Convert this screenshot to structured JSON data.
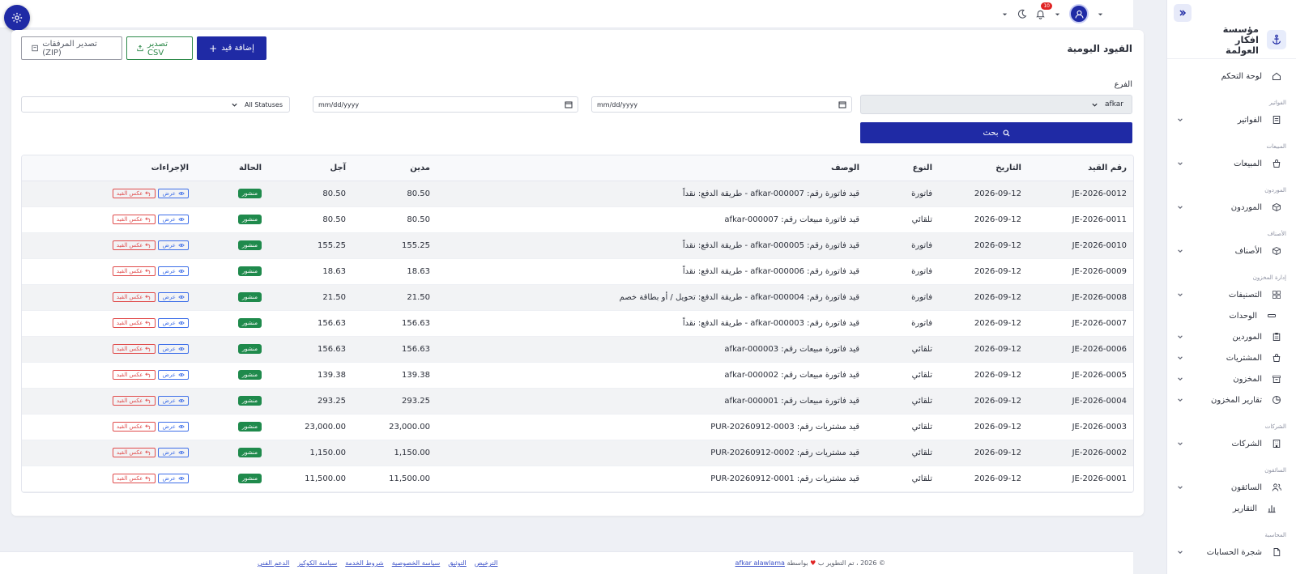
{
  "topbar": {
    "notification_count": "10"
  },
  "sidebar": {
    "brand_name": "مؤسسة افكار العولمة",
    "items": [
      {
        "type": "item",
        "label": "لوحة التحكم",
        "icon": "home-icon",
        "chevron": false
      },
      {
        "type": "section",
        "label": "الفواتير"
      },
      {
        "type": "item",
        "label": "الفواتير",
        "icon": "invoice-icon",
        "chevron": true
      },
      {
        "type": "section",
        "label": "المبيعات"
      },
      {
        "type": "item",
        "label": "المبيعات",
        "icon": "bag-icon",
        "chevron": true
      },
      {
        "type": "section",
        "label": "الموردون"
      },
      {
        "type": "item",
        "label": "الموردون",
        "icon": "box-icon",
        "chevron": true
      },
      {
        "type": "section",
        "label": "الأصناف"
      },
      {
        "type": "item",
        "label": "الأصناف",
        "icon": "box-icon",
        "chevron": true
      },
      {
        "type": "section",
        "label": "إدارة المخزون"
      },
      {
        "type": "item",
        "label": "التصنيفات",
        "icon": "grid-icon",
        "chevron": true
      },
      {
        "type": "sub",
        "label": "الوحدات",
        "icon": "unit-icon",
        "chevron": false
      },
      {
        "type": "item",
        "label": "الموردين",
        "icon": "clipboard-icon",
        "chevron": true
      },
      {
        "type": "item",
        "label": "المشتريات",
        "icon": "bag-icon",
        "chevron": true
      },
      {
        "type": "item",
        "label": "المخزون",
        "icon": "archive-icon",
        "chevron": true
      },
      {
        "type": "item",
        "label": "تقارير المخزون",
        "icon": "pie-icon",
        "chevron": true
      },
      {
        "type": "section",
        "label": "الشركات"
      },
      {
        "type": "item",
        "label": "الشركات",
        "icon": "building-icon",
        "chevron": true
      },
      {
        "type": "section",
        "label": "السائقون"
      },
      {
        "type": "item",
        "label": "السائقون",
        "icon": "users-icon",
        "chevron": true
      },
      {
        "type": "sub",
        "label": "التقارير",
        "icon": "bars-icon",
        "chevron": false
      },
      {
        "type": "section",
        "label": "المحاسبة"
      },
      {
        "type": "item",
        "label": "شجرة الحسابات",
        "icon": "doc-icon",
        "chevron": true
      }
    ]
  },
  "page": {
    "title": "القيود اليومية",
    "add_button": "إضافة قيد",
    "csv_button": "تصدير CSV",
    "zip_button": "تصدير المرفقات (ZIP)"
  },
  "filters": {
    "branch_label": "الفرع",
    "branch_value": "afkar",
    "date_from_placeholder": "mm/dd/yyyy",
    "date_to_placeholder": "mm/dd/yyyy",
    "status_value": "All Statuses",
    "search_button": "بحث"
  },
  "table": {
    "headers": [
      "رقم القيد",
      "التاريخ",
      "النوع",
      "الوصف",
      "مدين",
      "آجل",
      "الحالة",
      "الإجراءات"
    ],
    "view_label": "عرض",
    "reverse_label": "عكس القيد",
    "rows": [
      {
        "id": "JE-2026-0012",
        "date": "2026-09-12",
        "type": "فاتورة",
        "desc": "قيد فاتورة رقم: afkar-000007 - طريقة الدفع: نقداً",
        "debit": "80.50",
        "credit": "80.50",
        "status": "منشور"
      },
      {
        "id": "JE-2026-0011",
        "date": "2026-09-12",
        "type": "تلقائي",
        "desc": "قيد فاتورة مبيعات رقم: afkar-000007",
        "debit": "80.50",
        "credit": "80.50",
        "status": "منشور"
      },
      {
        "id": "JE-2026-0010",
        "date": "2026-09-12",
        "type": "فاتورة",
        "desc": "قيد فاتورة رقم: afkar-000005 - طريقة الدفع: نقداً",
        "debit": "155.25",
        "credit": "155.25",
        "status": "منشور"
      },
      {
        "id": "JE-2026-0009",
        "date": "2026-09-12",
        "type": "فاتورة",
        "desc": "قيد فاتورة رقم: afkar-000006 - طريقة الدفع: نقداً",
        "debit": "18.63",
        "credit": "18.63",
        "status": "منشور"
      },
      {
        "id": "JE-2026-0008",
        "date": "2026-09-12",
        "type": "فاتورة",
        "desc": "قيد فاتورة رقم: afkar-000004 - طريقة الدفع: تحويل / أو بطاقة خصم",
        "debit": "21.50",
        "credit": "21.50",
        "status": "منشور"
      },
      {
        "id": "JE-2026-0007",
        "date": "2026-09-12",
        "type": "فاتورة",
        "desc": "قيد فاتورة رقم: afkar-000003 - طريقة الدفع: نقداً",
        "debit": "156.63",
        "credit": "156.63",
        "status": "منشور"
      },
      {
        "id": "JE-2026-0006",
        "date": "2026-09-12",
        "type": "تلقائي",
        "desc": "قيد فاتورة مبيعات رقم: afkar-000003",
        "debit": "156.63",
        "credit": "156.63",
        "status": "منشور"
      },
      {
        "id": "JE-2026-0005",
        "date": "2026-09-12",
        "type": "تلقائي",
        "desc": "قيد فاتورة مبيعات رقم: afkar-000002",
        "debit": "139.38",
        "credit": "139.38",
        "status": "منشور"
      },
      {
        "id": "JE-2026-0004",
        "date": "2026-09-12",
        "type": "تلقائي",
        "desc": "قيد فاتورة مبيعات رقم: afkar-000001",
        "debit": "293.25",
        "credit": "293.25",
        "status": "منشور"
      },
      {
        "id": "JE-2026-0003",
        "date": "2026-09-12",
        "type": "تلقائي",
        "desc": "قيد مشتريات رقم: PUR-20260912-0003",
        "debit": "23,000.00",
        "credit": "23,000.00",
        "status": "منشور"
      },
      {
        "id": "JE-2026-0002",
        "date": "2026-09-12",
        "type": "تلقائي",
        "desc": "قيد مشتريات رقم: PUR-20260912-0002",
        "debit": "1,150.00",
        "credit": "1,150.00",
        "status": "منشور"
      },
      {
        "id": "JE-2026-0001",
        "date": "2026-09-12",
        "type": "تلقائي",
        "desc": "قيد مشتريات رقم: PUR-20260912-0001",
        "debit": "11,500.00",
        "credit": "11,500.00",
        "status": "منشور"
      }
    ]
  },
  "footer": {
    "copyright": "© 2026 ، تم التطوير ب",
    "by": "بواسطة",
    "author": "afkar alawlama",
    "links": [
      "الترخيص",
      "التوثيق",
      "سياسة الخصوصية",
      "شروط الخدمة",
      "سياسة الكوكيز",
      "الدعم الفني"
    ]
  },
  "colors": {
    "primary": "#1f2aa5",
    "success": "#1f8a4c",
    "danger": "#e04b4b",
    "link": "#3d6ee8"
  }
}
